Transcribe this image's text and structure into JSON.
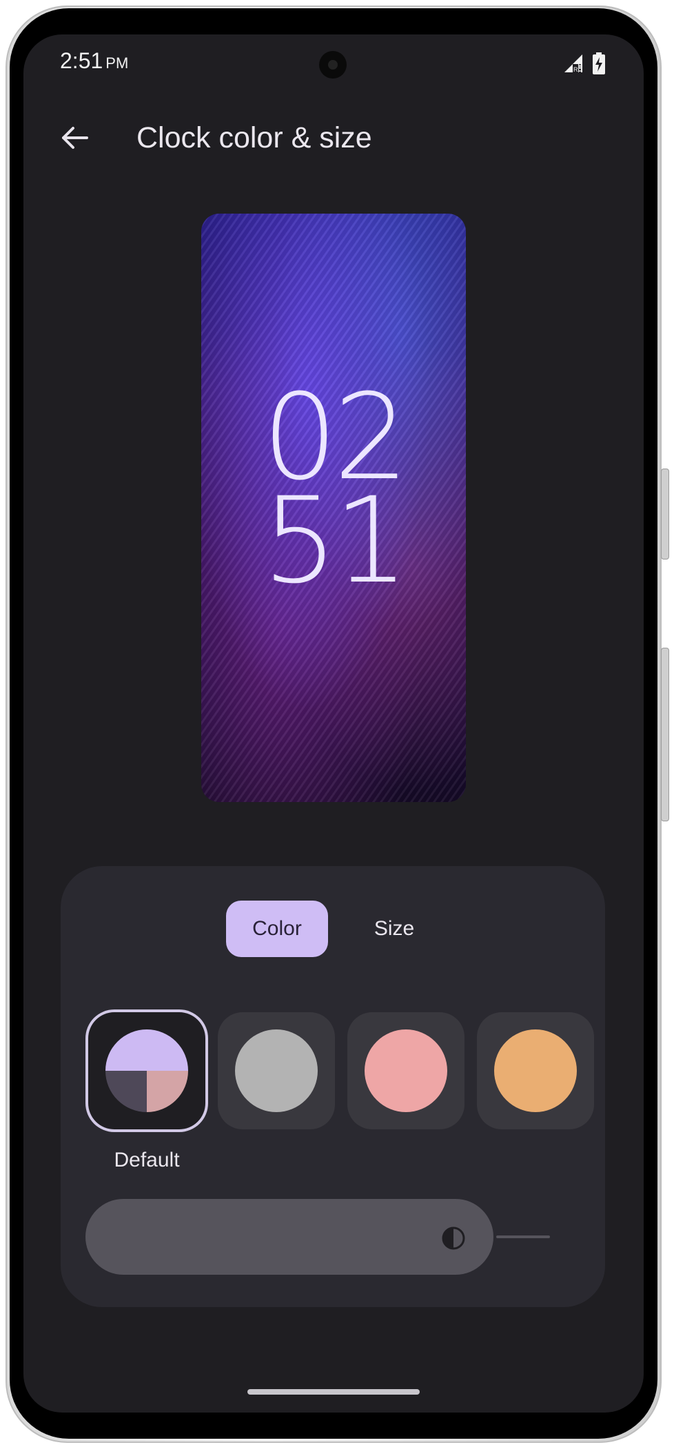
{
  "status_bar": {
    "time": "2:51",
    "ampm": "PM",
    "icons": [
      "signal-icon",
      "battery-charging-icon"
    ]
  },
  "header": {
    "back_icon": "arrow-back-icon",
    "title": "Clock color & size"
  },
  "preview": {
    "clock_hour": "02",
    "clock_minute": "51",
    "clock_color": "#ece6ff"
  },
  "panel": {
    "tabs": [
      {
        "label": "Color",
        "selected": true
      },
      {
        "label": "Size",
        "selected": false
      }
    ],
    "swatches": [
      {
        "name": "Default",
        "colors": [
          "#cdbaf3",
          "#4e4858",
          "#d4a4a6"
        ],
        "selected": true
      },
      {
        "name": "Gray",
        "colors": [
          "#b3b3b3"
        ],
        "selected": false
      },
      {
        "name": "Pink",
        "colors": [
          "#eea6a6"
        ],
        "selected": false
      },
      {
        "name": "Orange",
        "colors": [
          "#eaae72"
        ],
        "selected": false
      }
    ],
    "selected_label": "Default",
    "slider": {
      "icon": "contrast-icon",
      "value_fraction": 0.75
    }
  },
  "colors": {
    "background": "#1f1e22",
    "panel": "#2a2930",
    "accent": "#cfbdf5"
  }
}
